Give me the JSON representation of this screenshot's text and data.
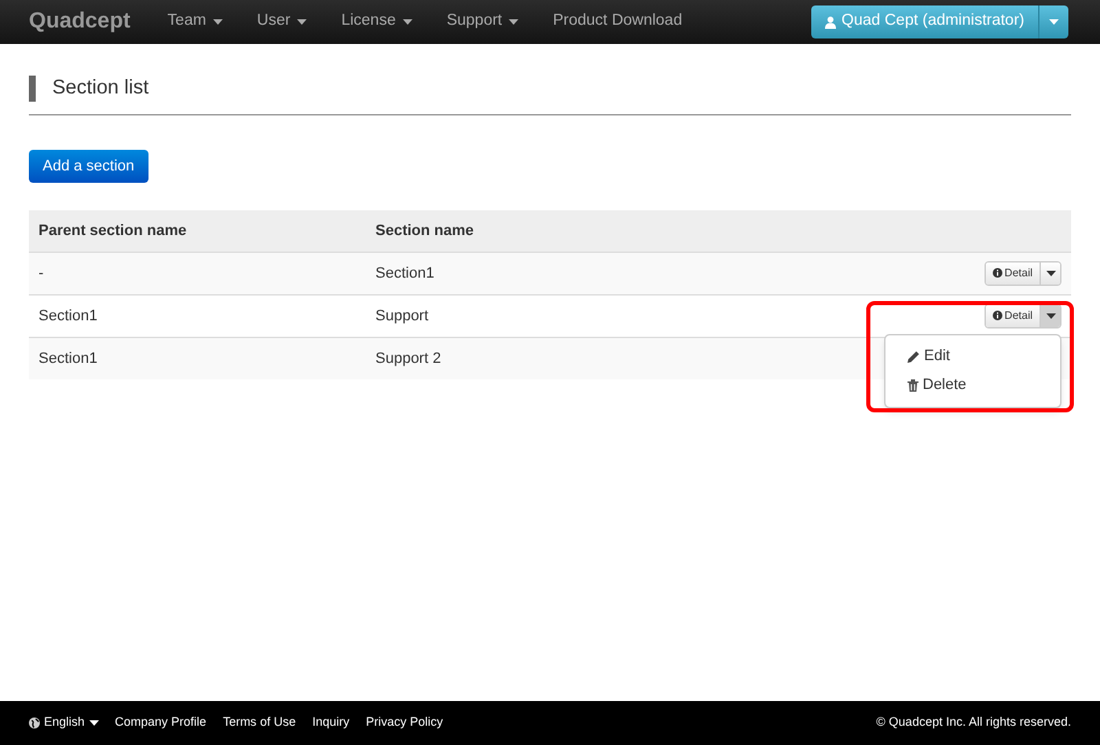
{
  "navbar": {
    "brand": "Quadcept",
    "menus": [
      {
        "label": "Team",
        "dropdown": true
      },
      {
        "label": "User",
        "dropdown": true
      },
      {
        "label": "License",
        "dropdown": true
      },
      {
        "label": "Support",
        "dropdown": true
      },
      {
        "label": "Product Download",
        "dropdown": false
      }
    ],
    "account": "Quad Cept (administrator)"
  },
  "page_title": "Section list",
  "add_button": "Add a section",
  "table": {
    "columns": [
      "Parent section name",
      "Section name"
    ],
    "rows": [
      {
        "parent": "-",
        "name": "Section1",
        "action": "Detail",
        "menu_open": false
      },
      {
        "parent": "Section1",
        "name": "Support",
        "action": "Detail",
        "menu_open": true
      },
      {
        "parent": "Section1",
        "name": "Support 2",
        "menu_open": false
      }
    ]
  },
  "action_menu": {
    "items": [
      {
        "label": "Edit",
        "kind": "edit"
      },
      {
        "label": "Delete",
        "kind": "delete"
      }
    ],
    "highlighted": true
  },
  "footer": {
    "language": "English",
    "links": [
      "Company Profile",
      "Terms of Use",
      "Inquiry",
      "Privacy Policy"
    ],
    "copyright": "© Quadcept Inc. All rights reserved."
  }
}
